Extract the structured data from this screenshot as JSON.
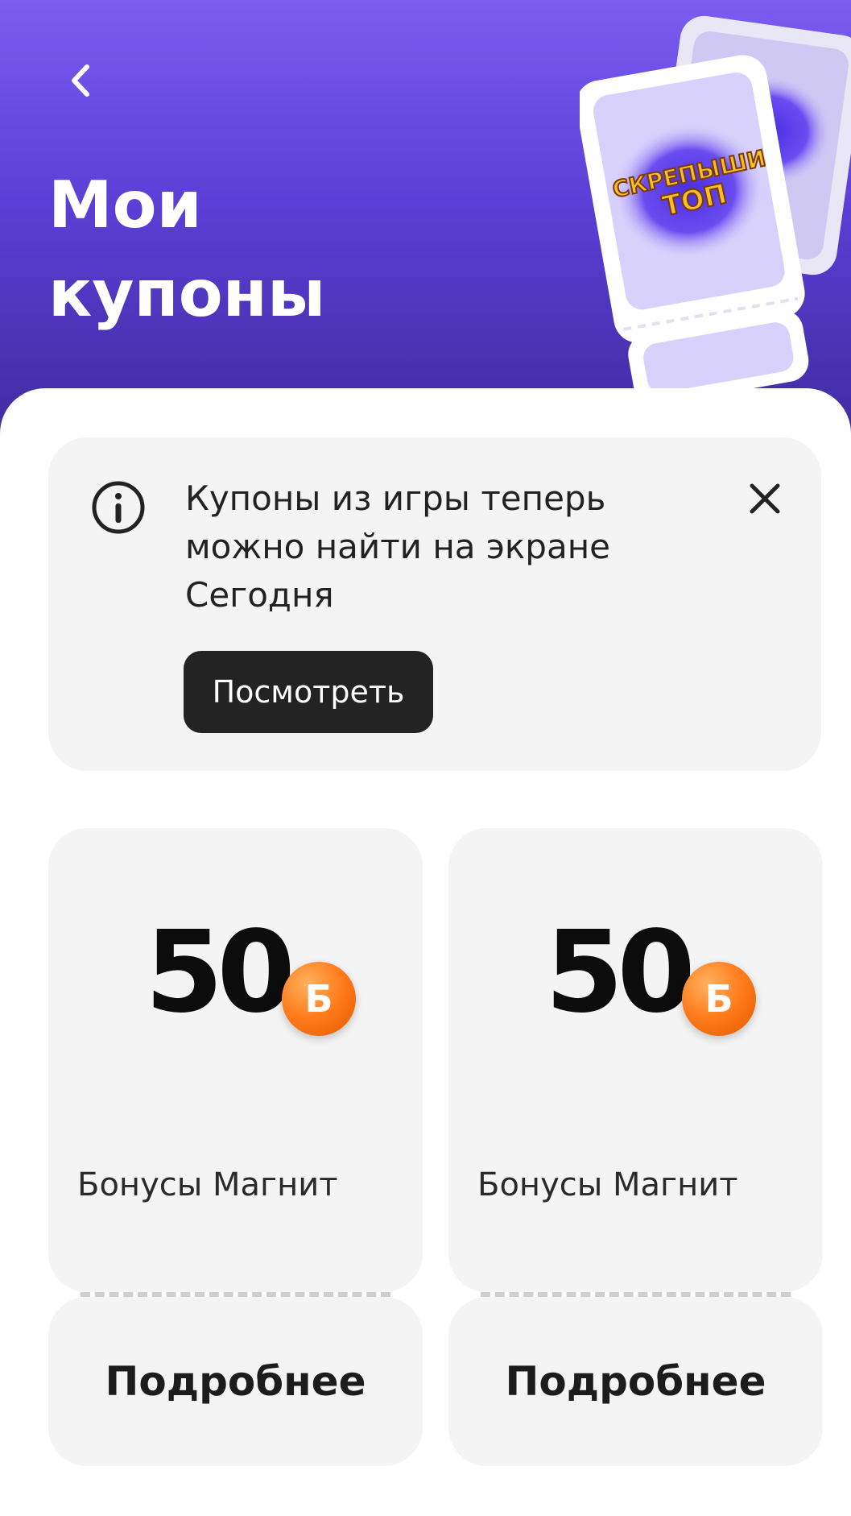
{
  "header": {
    "title": "Мои купоны",
    "promo_art_text_line1": "СКРЕПЫШИ",
    "promo_art_text_line2": "ТОП",
    "gradient_top": "#7a5cf0",
    "gradient_bottom": "#3f2a9d"
  },
  "info_banner": {
    "text": "Купоны из игры теперь можно найти на экране Сегодня",
    "button_label": "Посмотреть",
    "icon": "info-icon",
    "close_icon": "close-icon"
  },
  "coupons": [
    {
      "amount": "50",
      "currency_symbol": "Б",
      "label": "Бонусы Магнит",
      "details_label": "Подробнее"
    },
    {
      "amount": "50",
      "currency_symbol": "Б",
      "label": "Бонусы Магнит",
      "details_label": "Подробнее"
    }
  ],
  "colors": {
    "accent_orange": "#ff7a1a",
    "dark_button": "#232323",
    "card_bg": "#f4f4f5"
  }
}
